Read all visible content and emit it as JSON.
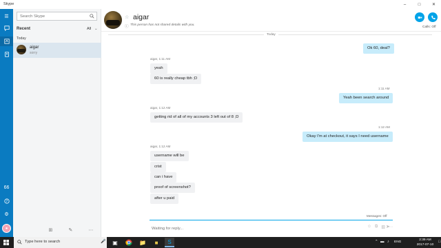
{
  "window": {
    "title": "Skype"
  },
  "search": {
    "placeholder": "Search Skype"
  },
  "panel": {
    "recent_label": "Recent",
    "filter_label": "All",
    "today_label": "Today"
  },
  "contact": {
    "name": "aigar",
    "subtitle": "sorry"
  },
  "chat_header": {
    "name": "aigar",
    "details": "This person has not shared details with you.",
    "calls_label": "Calls: Off"
  },
  "day_separator": "Today",
  "messages": [
    {
      "text": "Ok 60, deal?"
    },
    {
      "meta": "aigar, 1:11 AM"
    },
    {
      "text": "yeah"
    },
    {
      "text": "60 is really cheap tbh ;D"
    },
    {
      "meta": "1:11 AM"
    },
    {
      "text": "Yeah been search around"
    },
    {
      "meta": "aigar, 1:12 AM"
    },
    {
      "text": "getting rid of all of my accounts 3 left out of 8 ;D"
    },
    {
      "meta": "1:12 AM"
    },
    {
      "text": "Okay I'm at checkout, it says I need username"
    },
    {
      "meta": "aigar, 1:12 AM"
    },
    {
      "text": "username will be"
    },
    {
      "text": "crist"
    },
    {
      "text": "can i have"
    },
    {
      "text": "proof of screenshot?"
    },
    {
      "text": "after u paid"
    }
  ],
  "composer": {
    "placeholder": "Waiting for reply...",
    "messages_status": "Messages: Off"
  },
  "taskbar": {
    "search_placeholder": "Type here to search",
    "language": "ENG",
    "time": "2:39 AM",
    "date": "2017-07-10"
  },
  "colors": {
    "rail": "#0a7bc1",
    "accent": "#00a3e8",
    "outgoing_bubble": "#c7ecfb",
    "incoming_bubble": "#f0f1f3"
  }
}
